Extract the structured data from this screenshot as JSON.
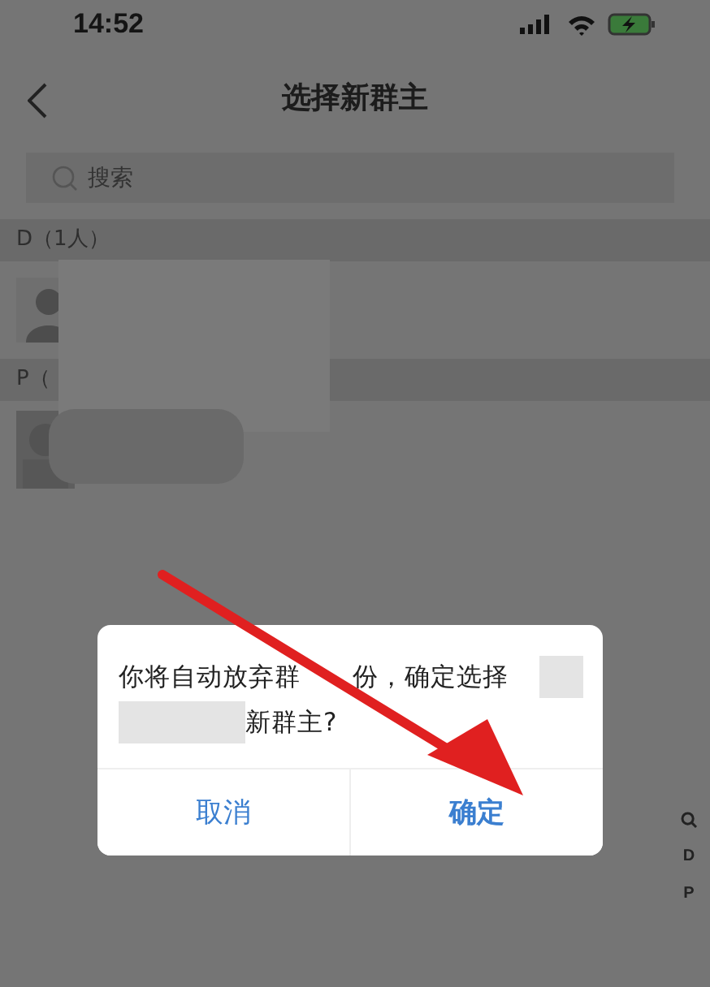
{
  "status_bar": {
    "time": "14:52"
  },
  "nav": {
    "title": "选择新群主"
  },
  "search": {
    "placeholder": "搜索"
  },
  "sections": [
    {
      "header": "D（1人）",
      "members": [
        {
          "kind": "silhouette"
        }
      ]
    },
    {
      "header": "P（"
    }
  ],
  "index_bar": [
    {
      "kind": "search"
    },
    {
      "kind": "letter",
      "label": "D"
    },
    {
      "kind": "letter",
      "label": "P"
    }
  ],
  "dialog": {
    "message_line_1": "你将自动放弃群",
    "message_line_1_after_arrow": "份，确定选择",
    "message_line_2": "新群主?",
    "buttons": [
      {
        "label": "取消",
        "kind": "cancel"
      },
      {
        "label": "确定",
        "kind": "confirm"
      }
    ]
  }
}
